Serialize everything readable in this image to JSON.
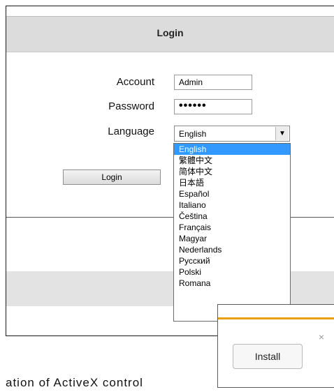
{
  "login_panel": {
    "title": "Login",
    "account_label": "Account",
    "account_value": "Admin",
    "password_label": "Password",
    "password_value": "••••••",
    "language_label": "Language",
    "language_selected": "English",
    "login_button": "Login"
  },
  "language_dropdown": {
    "options": [
      "English",
      "繁體中文",
      "简体中文",
      "日本語",
      "Español",
      "Italiano",
      "Čeština",
      "Français",
      "Magyar",
      "Nederlands",
      "Русский",
      "Polski",
      "Romana"
    ]
  },
  "install_popup": {
    "install_button": "Install",
    "close_glyph": "×"
  },
  "footer_text": "ation of ActiveX control",
  "colors": {
    "selection": "#3399ff",
    "header_bg": "#dcdcdc",
    "popup_accent": "#e8a10a"
  }
}
